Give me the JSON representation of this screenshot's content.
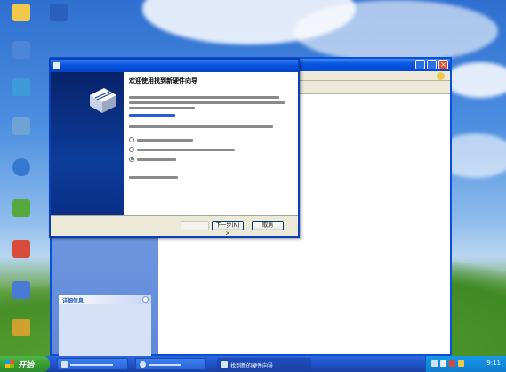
{
  "colors": {
    "title_bar_blue": "#0a55e0",
    "wizard_banner_navy": "#0c3c9a",
    "dialog_face": "#ece9d8",
    "taskbar_blue": "#245edb",
    "start_green": "#389e35",
    "tray_blue": "#1798e8",
    "close_red": "#e0512c"
  },
  "desktop": {
    "icons": [
      {
        "icon": "my-documents-icon",
        "color": "#f2c84b"
      },
      {
        "icon": "document-file-icon",
        "color": "#2b5fbd"
      },
      {
        "icon": "my-computer-icon",
        "color": "#4d86d8"
      },
      {
        "icon": "network-places-icon",
        "color": "#3f9ad8"
      },
      {
        "icon": "recycle-bin-icon",
        "color": "#6fa3d6"
      },
      {
        "icon": "internet-explorer-icon",
        "color": "#3478d0"
      },
      {
        "icon": "media-player-icon",
        "color": "#56a83e"
      },
      {
        "icon": "application-icon",
        "color": "#d84b3a"
      },
      {
        "icon": "shortcut-icon",
        "color": "#4a7ad6"
      },
      {
        "icon": "shortcut-icon",
        "color": "#d0a030"
      }
    ]
  },
  "wizard": {
    "title_icon": "hardware-wizard-icon",
    "banner_icon": "hardware-box-icon",
    "heading": "欢迎使用找到新硬件向导",
    "options": [
      {
        "selected": false
      },
      {
        "selected": false
      },
      {
        "selected": true
      }
    ],
    "next_label": "下一步(N) >",
    "cancel_label": "取消"
  },
  "background_window": {
    "close_glyph": "×",
    "panel_heading": "详细信息"
  },
  "taskbar": {
    "start_label": "开始",
    "tasks": [
      {
        "icon": "folder-icon"
      },
      {
        "icon": "browser-icon"
      },
      {
        "label": "找到新的硬件向导",
        "icon": "wizard-icon",
        "active": true
      }
    ],
    "tray_icons": [
      "network-icon",
      "volume-icon",
      "security-icon",
      "antivirus-icon"
    ],
    "clock": "9:11"
  }
}
